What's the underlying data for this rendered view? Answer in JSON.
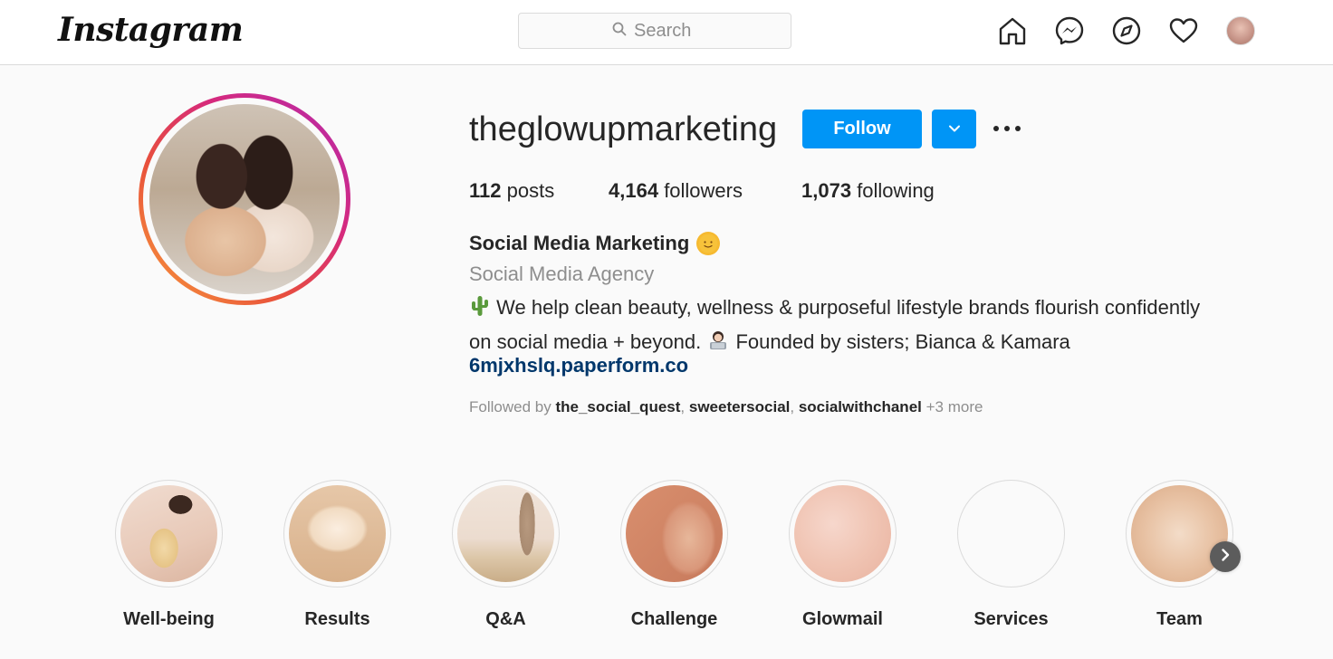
{
  "header": {
    "logo_text": "Instagram",
    "search_placeholder": "Search",
    "nav_icons": [
      "home-icon",
      "messenger-icon",
      "explore-compass-icon",
      "heart-activity-icon",
      "profile-avatar"
    ]
  },
  "profile": {
    "username": "theglowupmarketing",
    "follow_label": "Follow",
    "stats": {
      "posts_count": "112",
      "posts_label": "posts",
      "followers_count": "4,164",
      "followers_label": "followers",
      "following_count": "1,073",
      "following_label": "following"
    },
    "full_name": "Social Media Marketing",
    "category": "Social Media Agency",
    "bio_line1": "We help clean beauty, wellness & purposeful lifestyle brands flourish confidently",
    "bio_line2_a": "on social media + beyond.",
    "bio_line2_b": "Founded by sisters; Bianca & Kamara",
    "link": "6mjxhslq.paperform.co",
    "followed_by": {
      "prefix": "Followed by",
      "users": [
        "the_social_quest",
        "sweetersocial",
        "socialwithchanel"
      ],
      "more": "+3 more"
    }
  },
  "highlights": [
    {
      "label": "Well-being"
    },
    {
      "label": "Results"
    },
    {
      "label": "Q&A"
    },
    {
      "label": "Challenge"
    },
    {
      "label": "Glowmail"
    },
    {
      "label": "Services"
    },
    {
      "label": "Team"
    }
  ],
  "colors": {
    "primary_button": "#0095f6",
    "link": "#00376b",
    "secondary_text": "#8e8e8e",
    "border": "#dbdbdb"
  }
}
